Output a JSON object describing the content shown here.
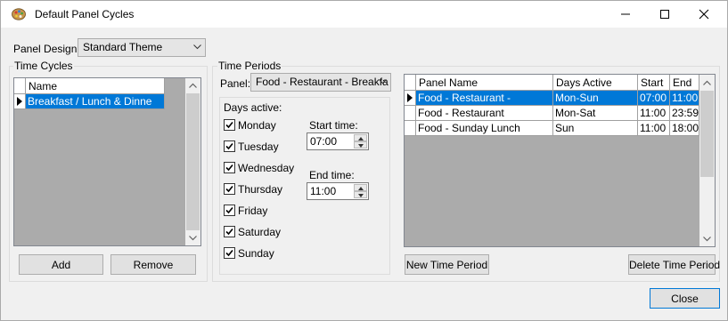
{
  "window": {
    "title": "Default Panel Cycles",
    "icon": "palette-icon"
  },
  "panel_design": {
    "label": "Panel Design:",
    "value": "Standard Theme"
  },
  "time_cycles": {
    "legend": "Time Cycles",
    "column_name": "Name",
    "rows": [
      "Breakfast / Lunch & Dinne"
    ],
    "add_label": "Add",
    "remove_label": "Remove"
  },
  "time_periods": {
    "legend": "Time Periods",
    "panel_label": "Panel:",
    "panel_value": "Food - Restaurant - Breakfa",
    "days_active_label": "Days active:",
    "days": [
      {
        "label": "Monday",
        "checked": true
      },
      {
        "label": "Tuesday",
        "checked": true
      },
      {
        "label": "Wednesday",
        "checked": true
      },
      {
        "label": "Thursday",
        "checked": true
      },
      {
        "label": "Friday",
        "checked": true
      },
      {
        "label": "Saturday",
        "checked": true
      },
      {
        "label": "Sunday",
        "checked": true
      }
    ],
    "start_time_label": "Start time:",
    "start_time_value": "07:00",
    "end_time_label": "End time:",
    "end_time_value": "11:00",
    "grid": {
      "columns": [
        "Panel Name",
        "Days Active",
        "Start",
        "End"
      ],
      "rows": [
        [
          "Food - Restaurant -",
          "Mon-Sun",
          "07:00",
          "11:00"
        ],
        [
          "Food - Restaurant",
          "Mon-Sat",
          "11:00",
          "23:59"
        ],
        [
          "Food - Sunday Lunch",
          "Sun",
          "11:00",
          "18:00"
        ]
      ],
      "selected_row": 0
    },
    "new_period_label": "New Time Period",
    "delete_period_label": "Delete Time Period"
  },
  "close_label": "Close",
  "colors": {
    "selection": "#0078d7",
    "window_bg": "#f0f0f0",
    "accent_border": "#0078d7"
  }
}
